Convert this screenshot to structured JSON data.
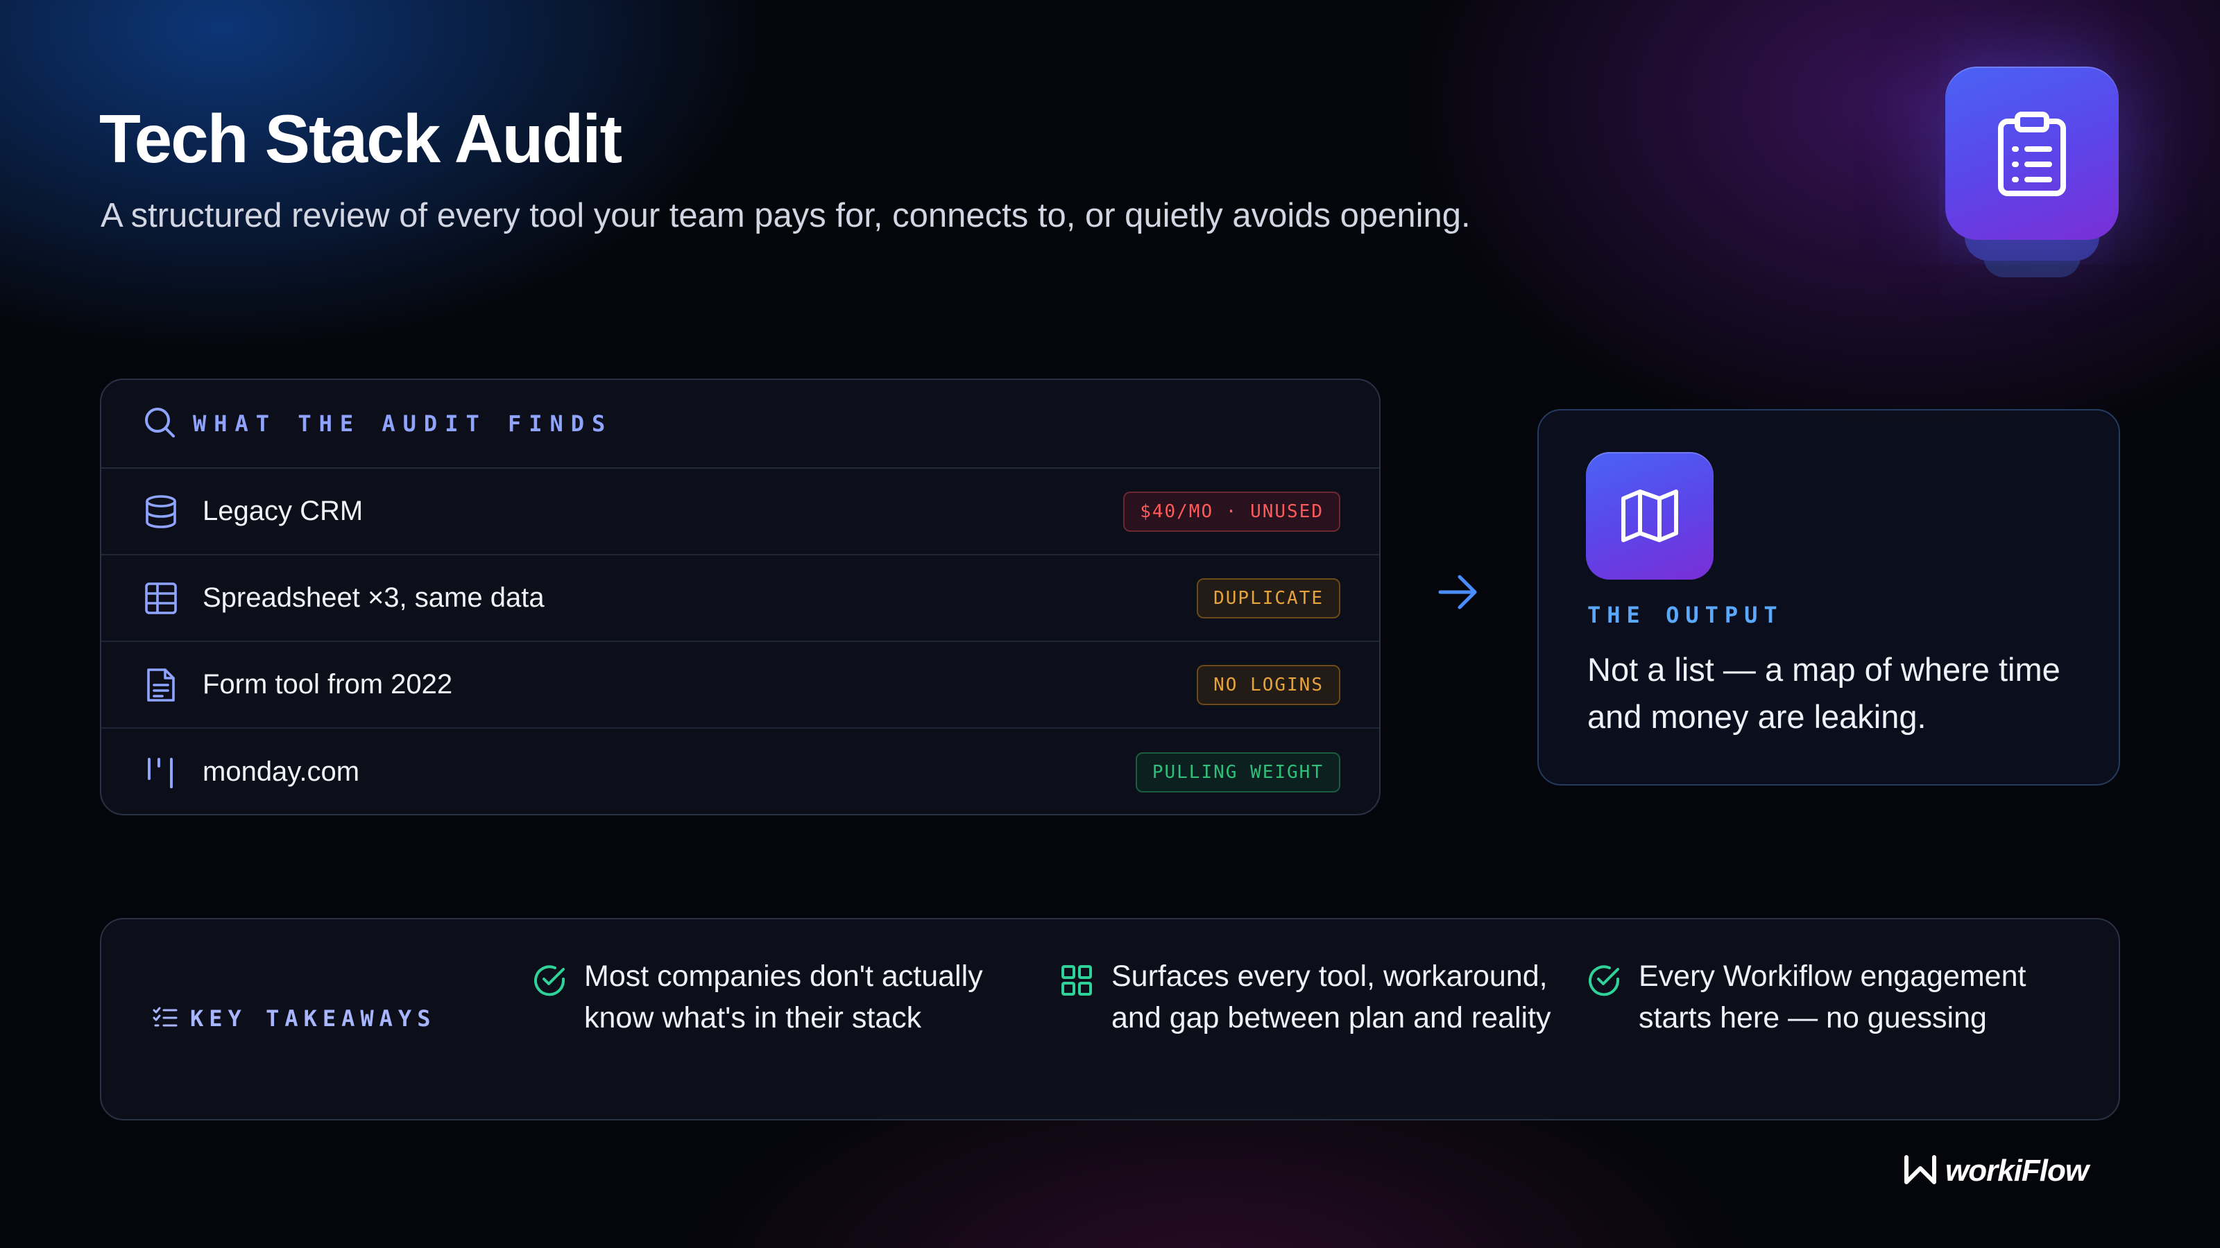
{
  "header": {
    "title": "Tech Stack Audit",
    "subtitle": "A structured review of every tool your team pays for, connects to, or quietly avoids opening."
  },
  "finds": {
    "heading": "WHAT THE AUDIT FINDS",
    "icon": "search-icon",
    "rows": [
      {
        "label": "Legacy CRM",
        "badge": "$40/MO · UNUSED",
        "icon": "database-icon",
        "badge_color": "#ff5a5a"
      },
      {
        "label": "Spreadsheet ×3, same data",
        "badge": "DUPLICATE",
        "icon": "table-icon",
        "badge_color": "#e6a23c"
      },
      {
        "label": "Form tool from 2022",
        "badge": "NO LOGINS",
        "icon": "document-icon",
        "badge_color": "#e6a23c"
      },
      {
        "label": "monday.com",
        "badge": "PULLING WEIGHT",
        "icon": "monday-logo-icon",
        "badge_color": "#2fbf7a"
      }
    ]
  },
  "output": {
    "label": "THE OUTPUT",
    "text": "Not a list — a map of where time and money are leaking.",
    "icon": "map-icon"
  },
  "takeaways": {
    "label": "KEY TAKEAWAYS",
    "icon": "list-check-icon",
    "items": [
      {
        "text": "Most companies don't actually know what's in their stack",
        "icon": "check-circle-icon"
      },
      {
        "text": "Surfaces every tool, workaround, and gap between plan and reality",
        "icon": "grid-icon"
      },
      {
        "text": "Every Workiflow engagement starts here — no guessing",
        "icon": "check-circle-icon"
      }
    ]
  },
  "brand": {
    "name": "workiFlow",
    "accent": "#8fa4ff",
    "icon_gradient": [
      "#4a63f5",
      "#7a2fd6"
    ]
  }
}
